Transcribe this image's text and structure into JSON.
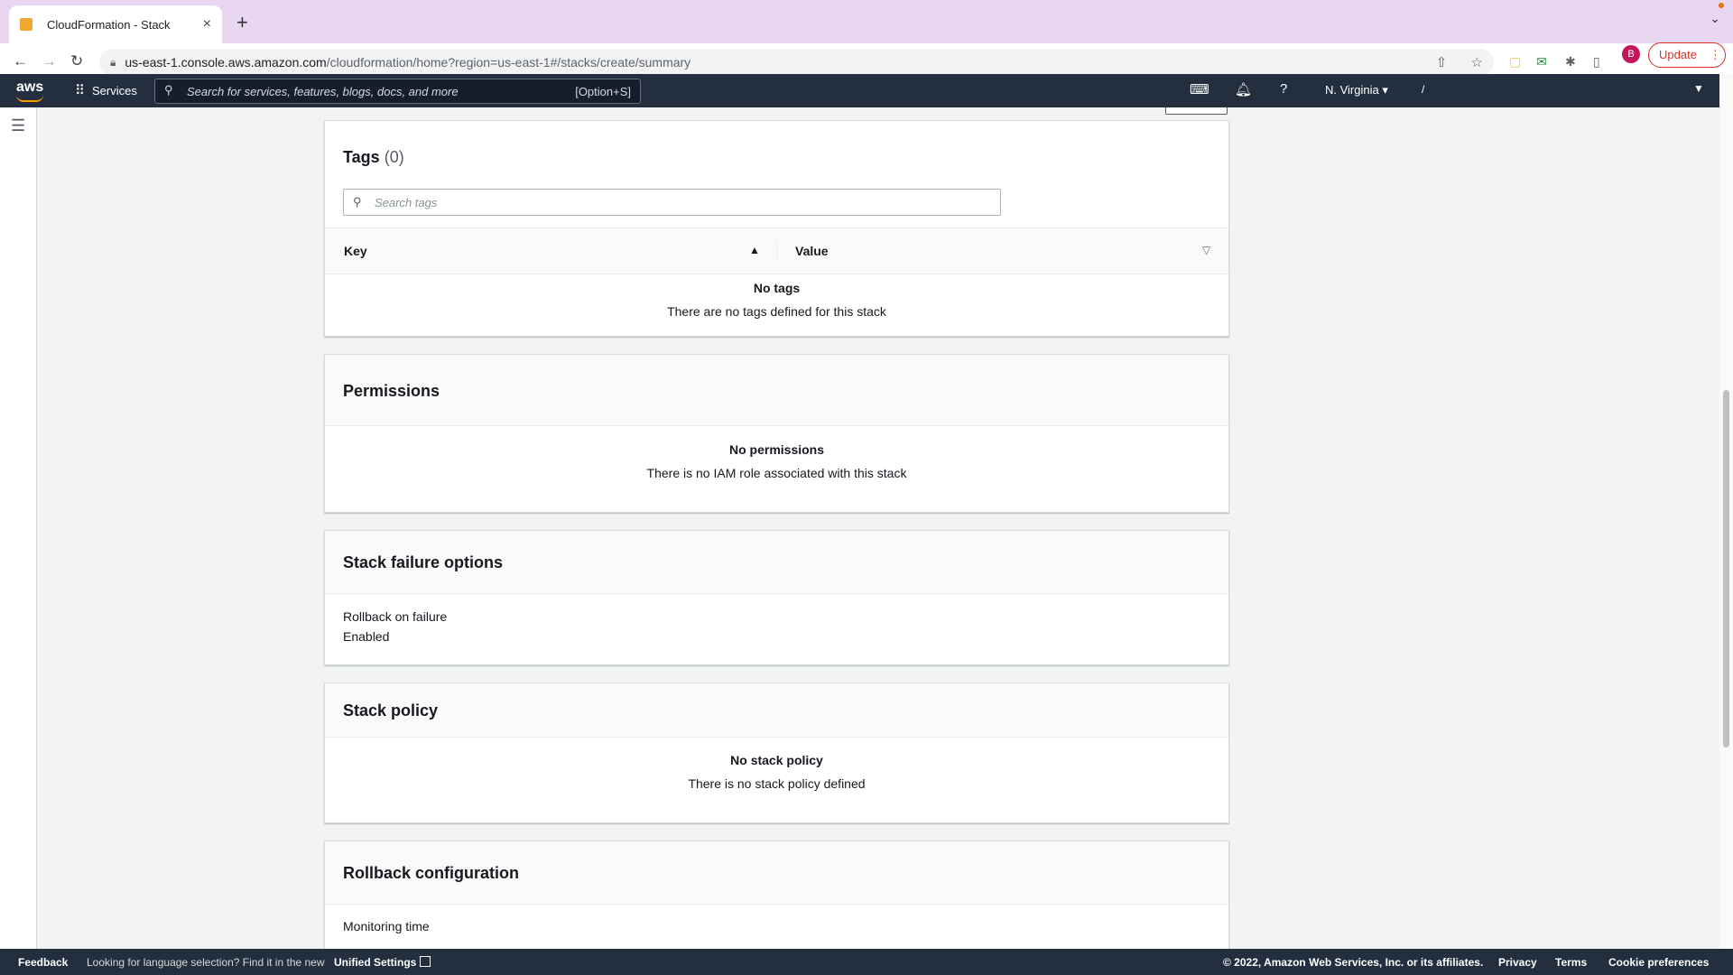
{
  "browser": {
    "tab_title": "CloudFormation - Stack",
    "url_host": "us-east-1.console.aws.amazon.com",
    "url_path": "/cloudformation/home?region=us-east-1#/stacks/create/summary",
    "profile_initial": "B",
    "update_label": "Update"
  },
  "aws_nav": {
    "logo": "aws",
    "services_label": "Services",
    "search_placeholder": "Search for services, features, blogs, docs, and more",
    "search_shortcut": "[Option+S]",
    "region": "N. Virginia",
    "account": "/"
  },
  "tags": {
    "title": "Tags",
    "count": "(0)",
    "search_placeholder": "Search tags",
    "col_key": "Key",
    "col_value": "Value",
    "empty_title": "No tags",
    "empty_desc": "There are no tags defined for this stack"
  },
  "permissions": {
    "title": "Permissions",
    "empty_title": "No permissions",
    "empty_desc": "There is no IAM role associated with this stack"
  },
  "failure": {
    "title": "Stack failure options",
    "label": "Rollback on failure",
    "value": "Enabled"
  },
  "policy": {
    "title": "Stack policy",
    "empty_title": "No stack policy",
    "empty_desc": "There is no stack policy defined"
  },
  "rollback": {
    "title": "Rollback configuration",
    "label": "Monitoring time"
  },
  "footer": {
    "feedback": "Feedback",
    "lang_text": "Looking for language selection? Find it in the new",
    "unified": "Unified Settings",
    "copyright": "© 2022, Amazon Web Services, Inc. or its affiliates.",
    "privacy": "Privacy",
    "terms": "Terms",
    "cookies": "Cookie preferences"
  },
  "colors": {
    "aws_nav": "#232f3e",
    "aws_orange": "#ff9900",
    "tabbar": "#e9d6f0",
    "update_red": "#d93025"
  }
}
